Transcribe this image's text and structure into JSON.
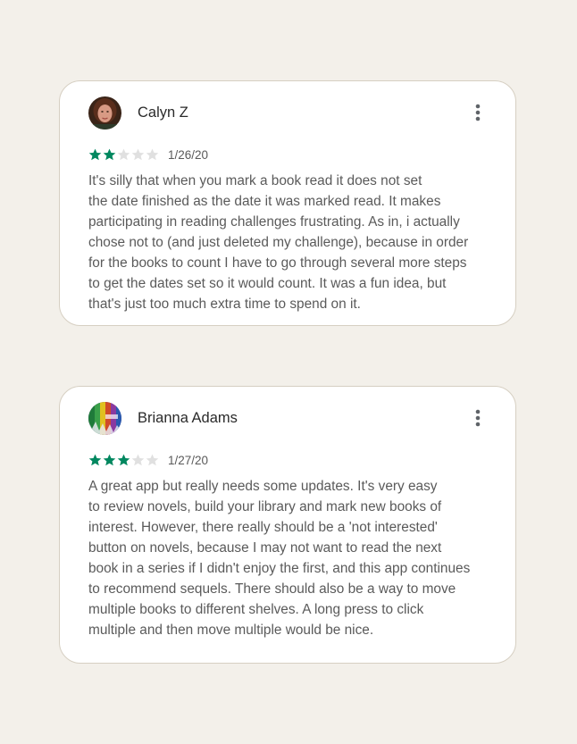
{
  "colors": {
    "background": "#f3f0ea",
    "card": "#ffffff",
    "star_filled": "#01875f",
    "star_empty": "#e0e0e0",
    "text": "#5a5a5a"
  },
  "reviews": [
    {
      "name": "Calyn Z",
      "avatar_icon": "user-photo-avatar",
      "rating": 2,
      "max_rating": 5,
      "date": "1/26/20",
      "menu_icon": "more-vert-icon",
      "text_lines": [
        "It's silly that when you mark a book read it does not set",
        "the date finished as the date it was marked read. It makes",
        "participating in reading challenges frustrating. As in, i actually",
        "chose not to (and just deleted my challenge), because in order",
        "for the books to count I have to go through several more steps",
        "to get the dates set so it would count. It was a fun idea, but",
        "that's just too much extra time to spend on it."
      ]
    },
    {
      "name": "Brianna Adams",
      "avatar_icon": "user-photo-avatar",
      "rating": 3,
      "max_rating": 5,
      "date": "1/27/20",
      "menu_icon": "more-vert-icon",
      "text_lines": [
        "A great app but really needs some updates. It's very easy",
        "to review novels, build your library and mark new books of",
        "interest. However, there really should be a 'not interested'",
        "button on novels, because I may not want to read the next",
        "book in a series if I didn't enjoy the first, and this app continues",
        "to recommend sequels. There should also be a way to move",
        "multiple books to different shelves. A long press to click",
        "multiple and then move multiple would be nice."
      ]
    }
  ]
}
